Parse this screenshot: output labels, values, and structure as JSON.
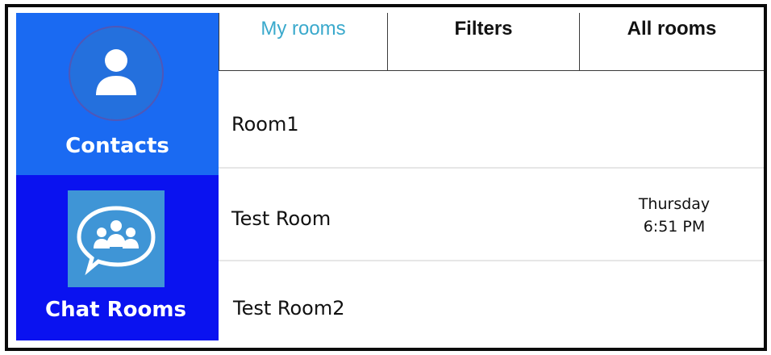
{
  "sidebar": {
    "contacts": {
      "label": "Contacts",
      "icon": "person-icon",
      "bg": "#1a6af2"
    },
    "chat_rooms": {
      "label": "Chat Rooms",
      "icon": "group-chat-icon",
      "bg": "#0a12f0"
    }
  },
  "tabs": [
    {
      "label": "My rooms",
      "active": true,
      "color": "#3aa9cc"
    },
    {
      "label": "Filters",
      "active": false
    },
    {
      "label": "All rooms",
      "active": false
    }
  ],
  "rooms": [
    {
      "name": "Room1",
      "day": "",
      "time": ""
    },
    {
      "name": "Test Room",
      "day": "Thursday",
      "time": "6:51 PM"
    },
    {
      "name": "Test Room2",
      "day": "",
      "time": ""
    }
  ]
}
